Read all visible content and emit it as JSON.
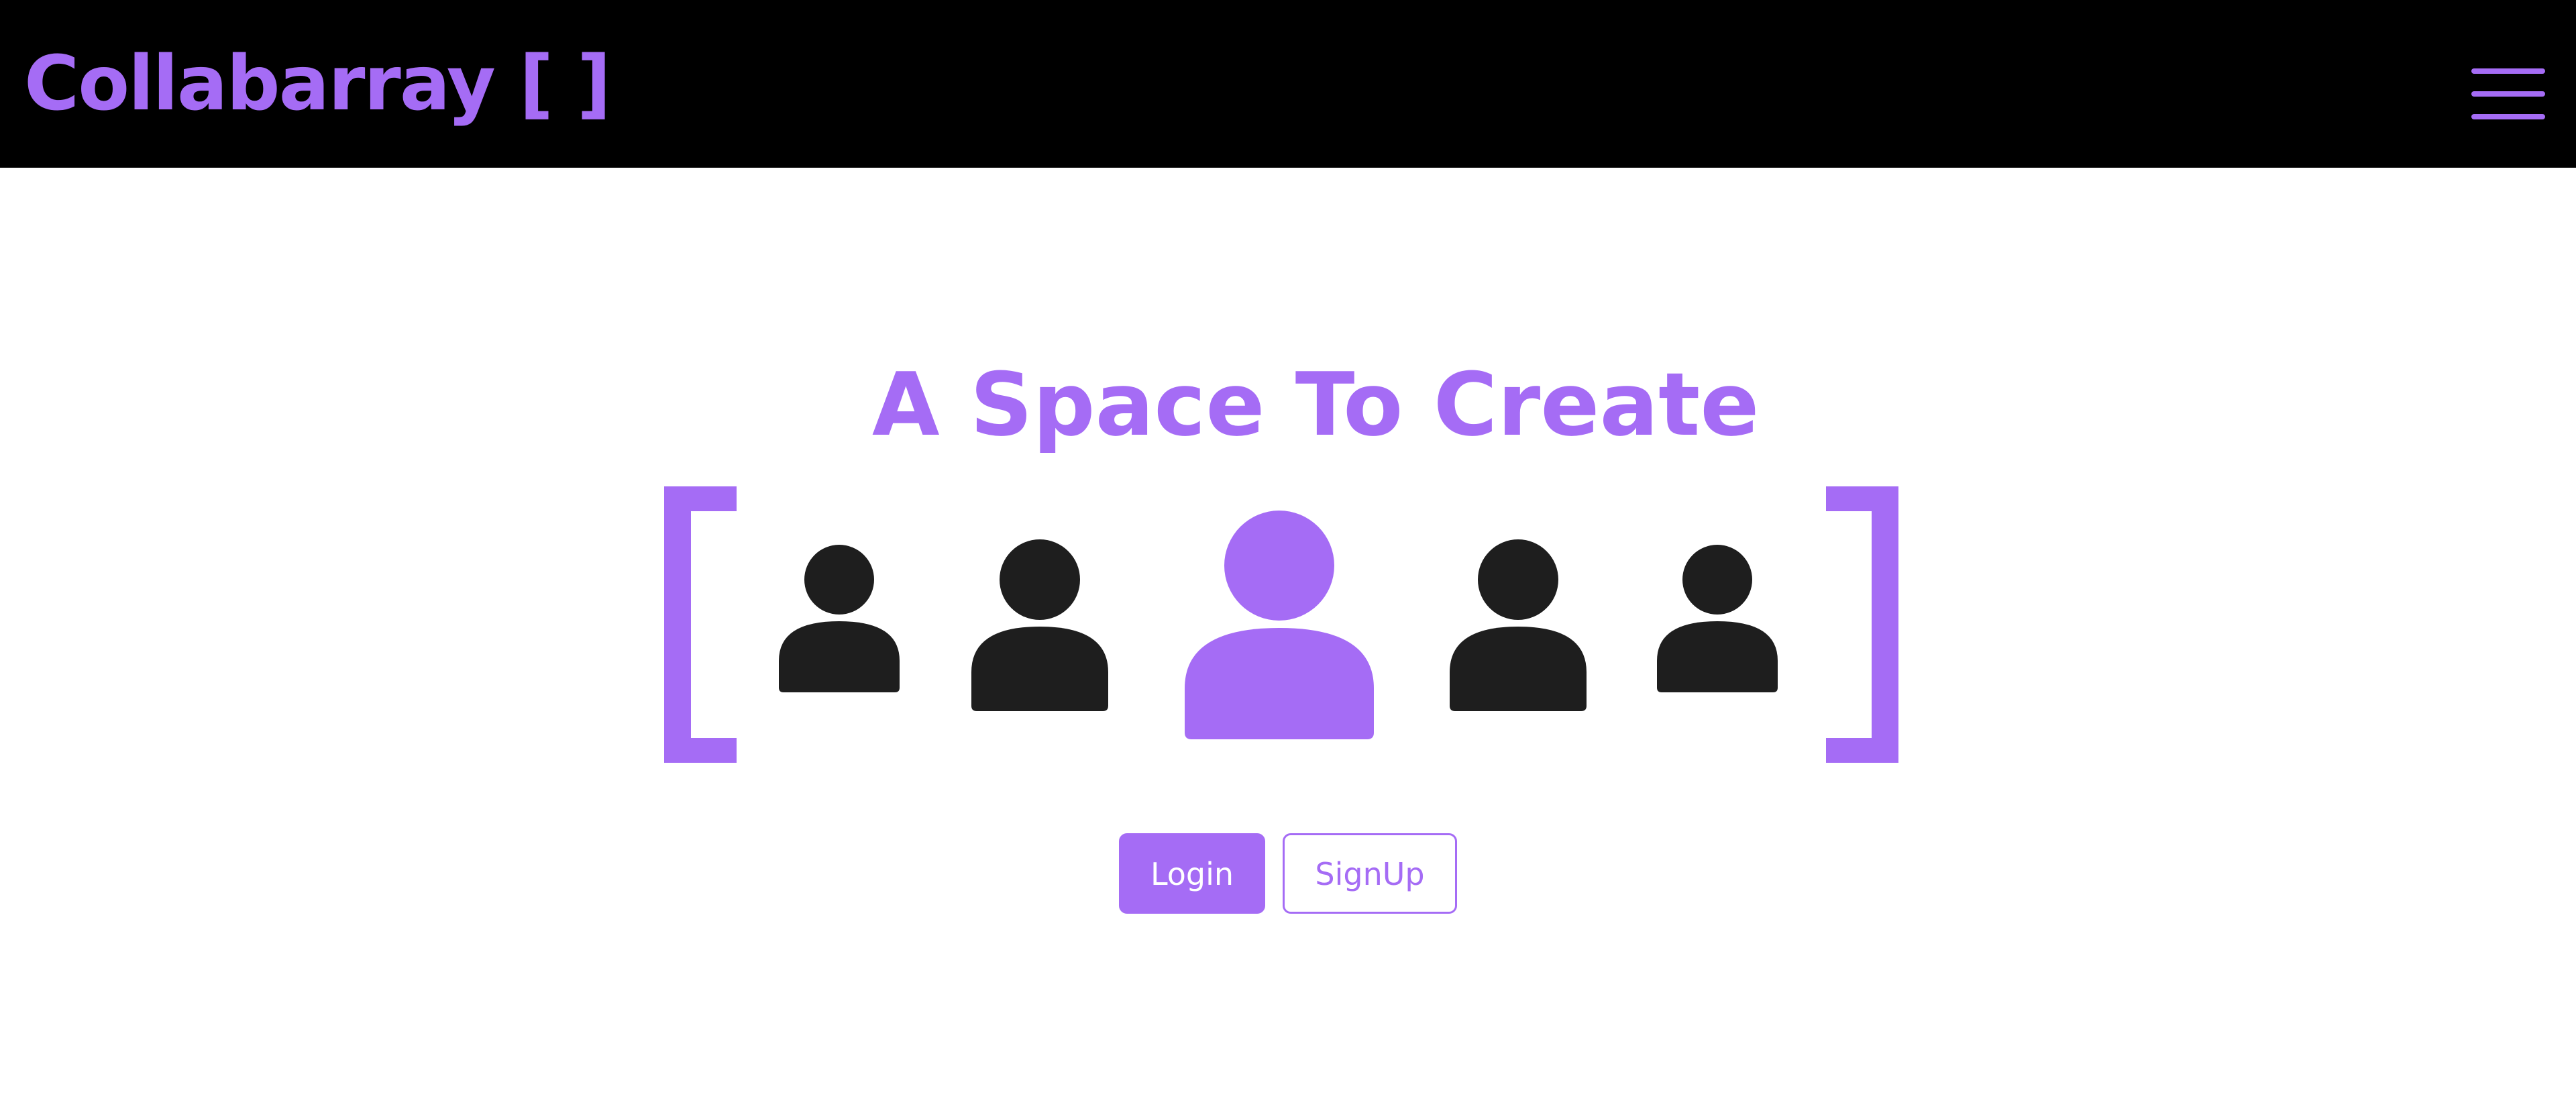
{
  "theme": {
    "accent": "#a56cf5",
    "navbar_bg": "#000000",
    "icon_dark": "#1e1e1e"
  },
  "navbar": {
    "brand": "Collabarray [ ]",
    "menu_icon": "hamburger-menu-icon"
  },
  "hero": {
    "tagline": "A Space To Create",
    "people_icons": [
      "person-icon",
      "person-icon",
      "person-icon-highlighted",
      "person-icon",
      "person-icon"
    ]
  },
  "actions": {
    "login_label": "Login",
    "signup_label": "SignUp"
  }
}
